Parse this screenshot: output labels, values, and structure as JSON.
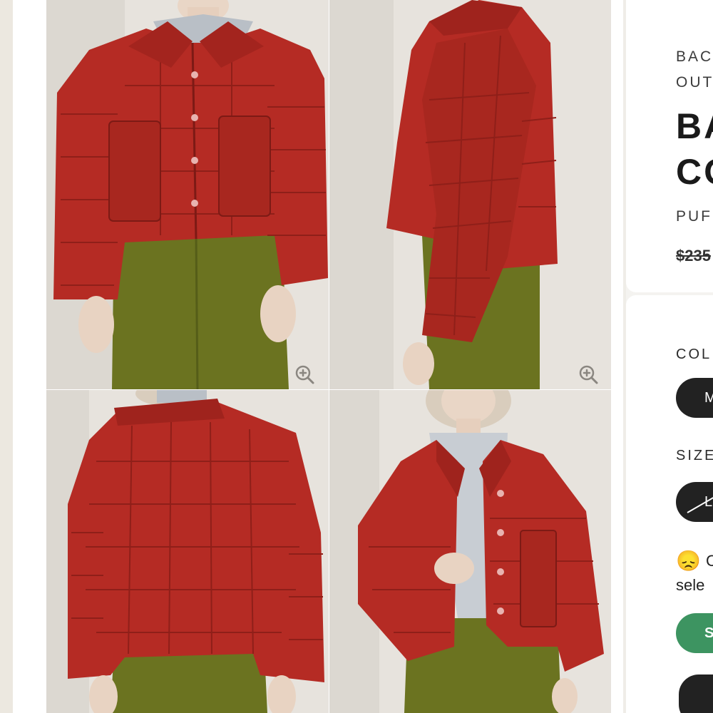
{
  "product": {
    "eyebrow_line1": "BAC",
    "eyebrow_line2": "OUT",
    "title_line1": "BA",
    "title_line2": "CO",
    "subtitle": "PUF",
    "price_original": "$235"
  },
  "options": {
    "color_label": "COL",
    "color_selected": "M",
    "size_label": "SIZE",
    "size_selected": "L"
  },
  "availability": {
    "emoji": "😞",
    "message_line1": "C",
    "message_line2": "sele"
  },
  "actions": {
    "primary_label": "S",
    "secondary_label": ""
  },
  "gallery": {
    "image_count": 4,
    "views": [
      "front",
      "side",
      "back",
      "front-open"
    ]
  },
  "colors": {
    "jacket": "#b52b24",
    "pants": "#6b7320",
    "primary_button": "#3d9461",
    "dark_pill": "#222222"
  },
  "icons": {
    "zoom": "zoom-in-icon"
  }
}
